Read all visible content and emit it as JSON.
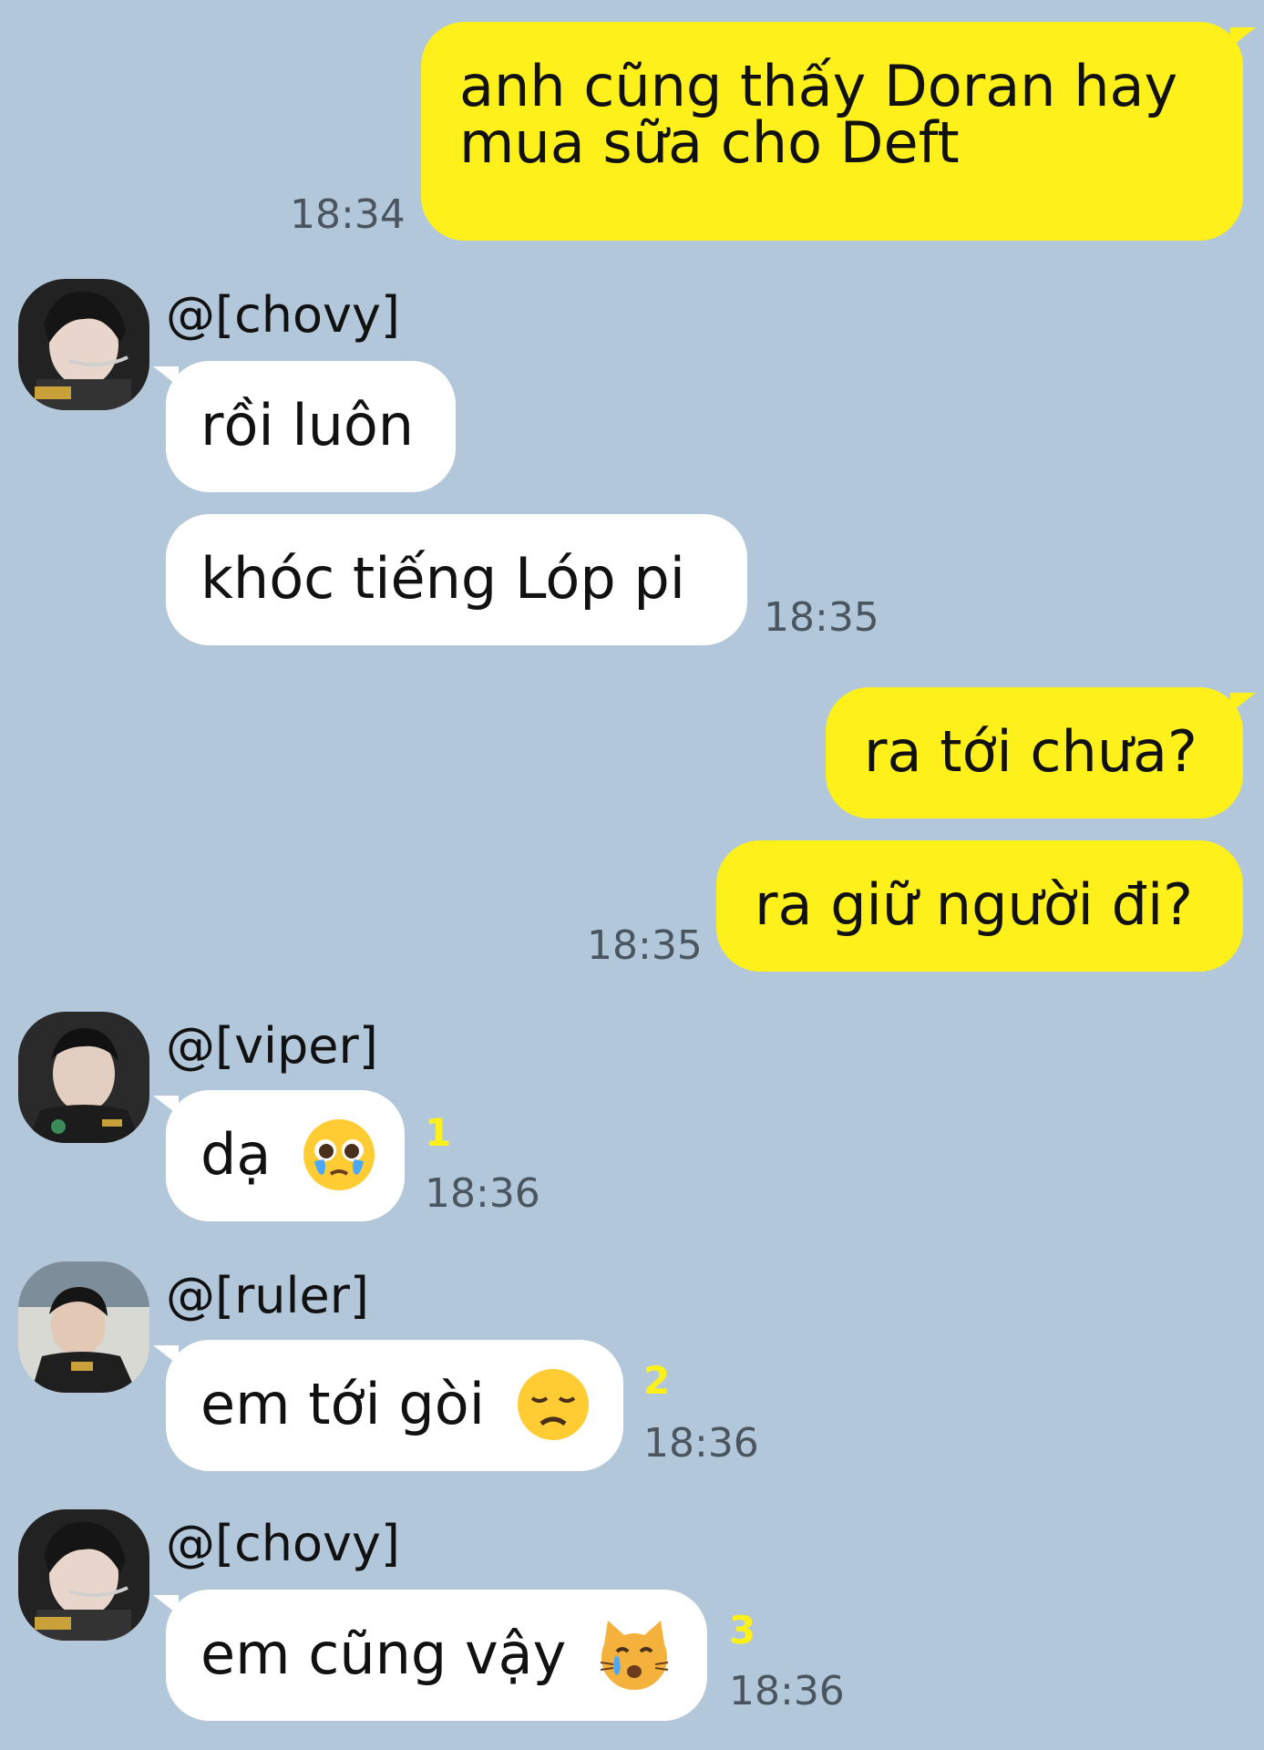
{
  "colors": {
    "background": "#b2c7da",
    "sent_bubble": "#fef01b",
    "received_bubble": "#ffffff",
    "unread_count": "#fef01b"
  },
  "messages": {
    "m1": {
      "line1": "anh cũng thấy Doran hay",
      "line2": "mua sữa cho Deft",
      "time": "18:34"
    },
    "chovy1": {
      "name": "@[chovy]",
      "msg1": "rồi luôn",
      "msg2": "khóc tiếng Lóp pi",
      "time": "18:35"
    },
    "m2": {
      "msg1": "ra tới chưa?",
      "msg2": "ra giữ người đi?",
      "time": "18:35"
    },
    "viper": {
      "name": "@[viper]",
      "msg": "dạ",
      "emoji": "pleading-tears-emoji-icon",
      "unread": "1",
      "time": "18:36"
    },
    "ruler": {
      "name": "@[ruler]",
      "msg": "em tới gòi",
      "emoji": "disappointed-face-emoji-icon",
      "unread": "2",
      "time": "18:36"
    },
    "chovy2": {
      "name": "@[chovy]",
      "msg": "em cũng vậy",
      "emoji": "crying-cat-emoji-icon",
      "unread": "3",
      "time": "18:36"
    }
  }
}
